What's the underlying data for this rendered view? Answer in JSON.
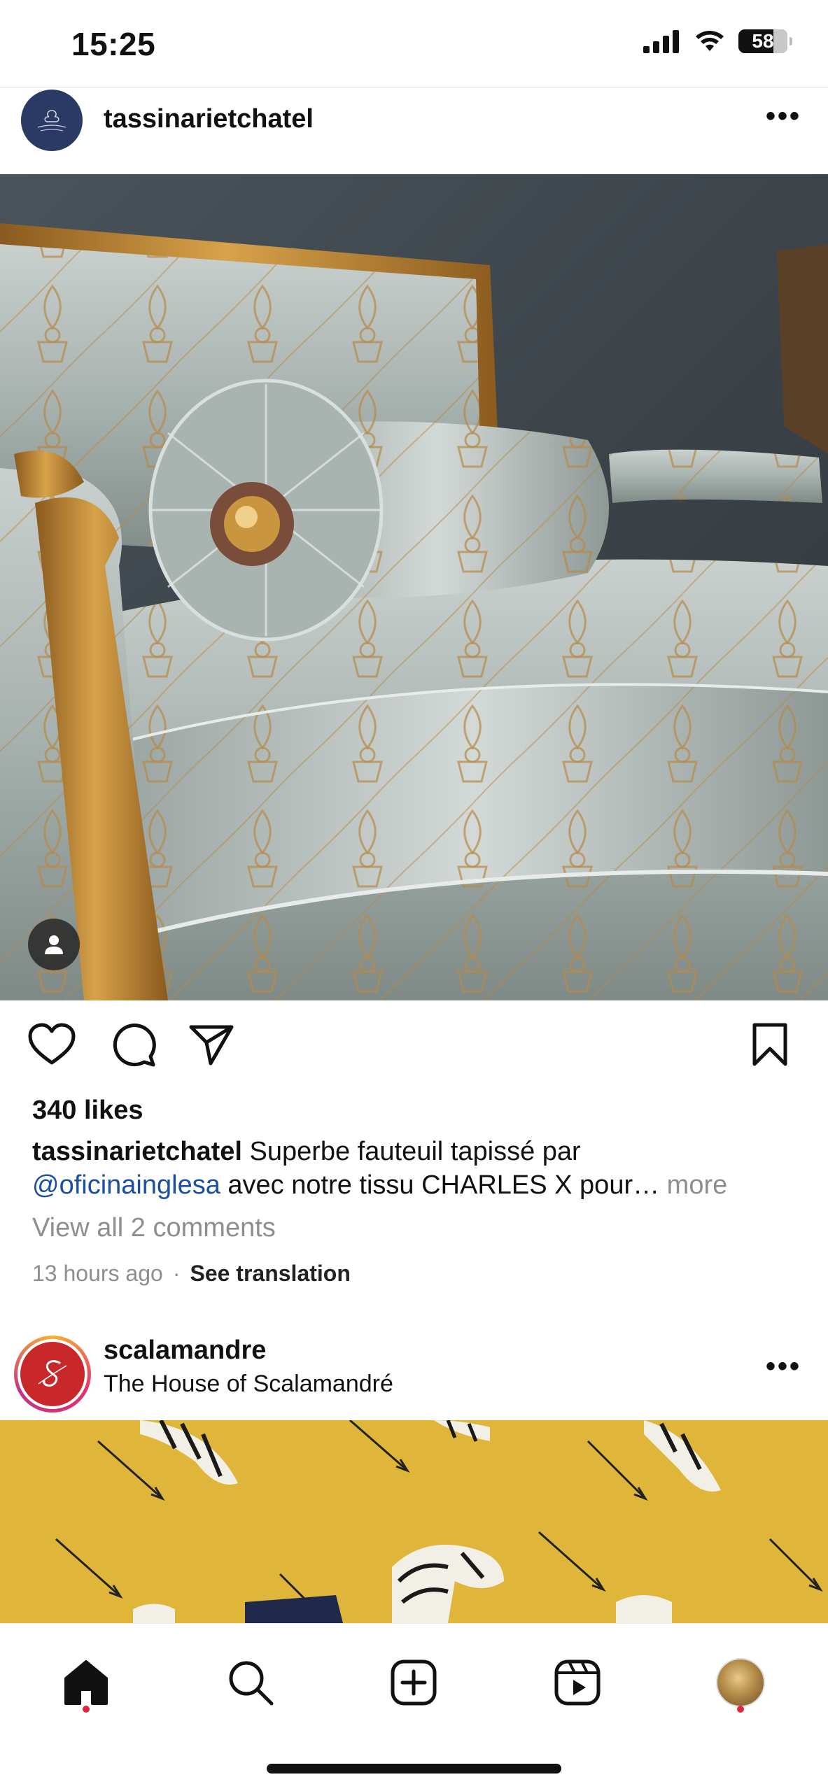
{
  "status_bar": {
    "time": "15:25",
    "battery": "58"
  },
  "post1": {
    "username": "tassinarietchatel",
    "avatar_icon": "tassinari-chatel-logo",
    "likes": "340 likes",
    "caption_user": "tassinarietchatel",
    "caption_text_1": " Superbe fauteuil tapissé par",
    "caption_mention": "@oficinainglesa",
    "caption_text_2": " avec notre tissu CHARLES X pour…",
    "caption_more": " more",
    "view_comments": "View all 2 comments",
    "time_ago": "13 hours ago",
    "separator": "·",
    "see_translation": "See translation",
    "more_menu": "•••"
  },
  "post2": {
    "username": "scalamandre",
    "subtitle": "The House of Scalamandré",
    "more_menu": "•••"
  },
  "colors": {
    "mention": "#1b4fa0",
    "notification_dot": "#e0263a",
    "muted_text": "#8e8e8e"
  },
  "nav": {
    "items": [
      "home-icon",
      "search-icon",
      "create-icon",
      "reels-icon",
      "profile-avatar"
    ]
  }
}
